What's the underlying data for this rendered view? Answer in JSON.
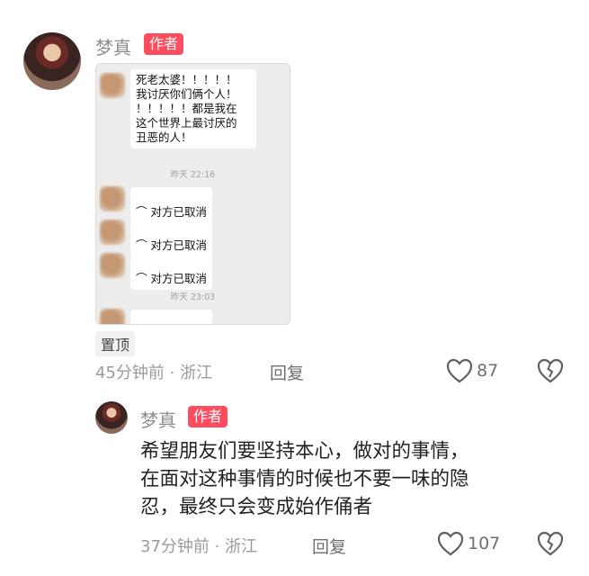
{
  "comment1": {
    "author": "梦真",
    "badge": "作者",
    "chat": {
      "message": "死老太婆！！！！！\n我讨厌你们俩个人！\n！！！！！都是我在\n这个世界上最讨厌的\n丑恶的人！",
      "timestamp1": "昨天 22:16",
      "cancelled_label": "对方已取消",
      "timestamp2": "昨天 23:03"
    },
    "pin_label": "置顶",
    "time_location": "45分钟前 · 浙江",
    "reply_label": "回复",
    "likes": "87"
  },
  "comment2": {
    "author": "梦真",
    "badge": "作者",
    "text": "希望朋友们要坚持本心，做对的事情，\n在面对这种事情的时候也不要一味的隐\n忍，最终只会变成始作俑者",
    "time_location": "37分钟前 · 浙江",
    "reply_label": "回复",
    "likes": "107"
  }
}
